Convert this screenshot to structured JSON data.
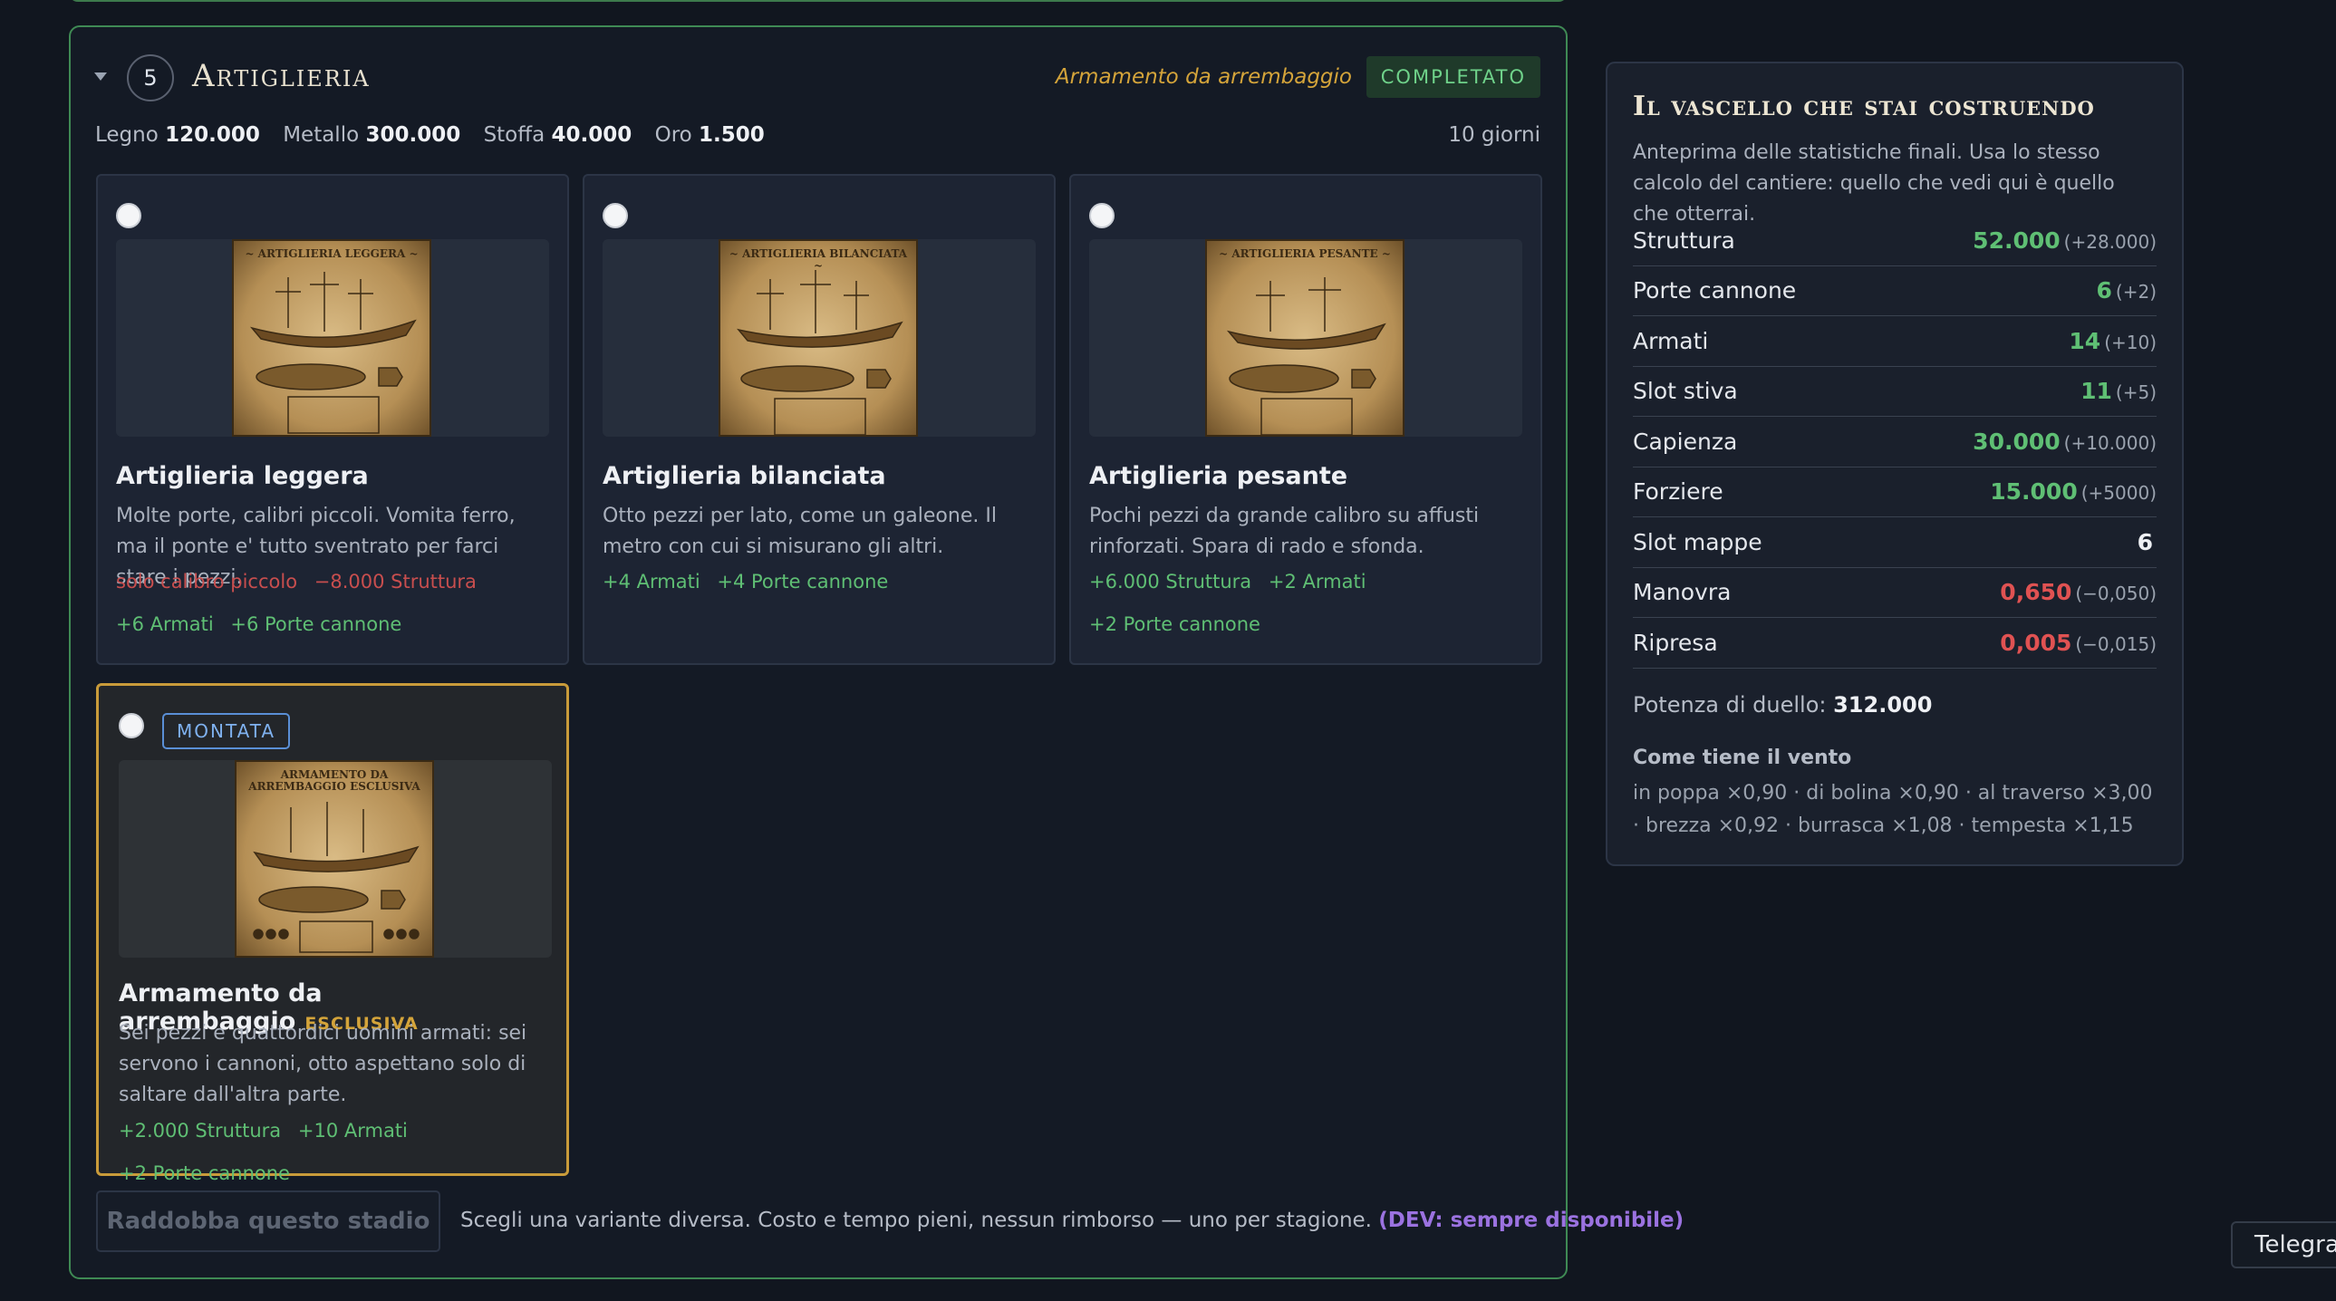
{
  "stage": {
    "number": "5",
    "title": "Artiglieria",
    "selected_label": "Armamento da arrembaggio",
    "status": "COMPLETATO",
    "costs": [
      {
        "name": "Legno",
        "amount": "120.000"
      },
      {
        "name": "Metallo",
        "amount": "300.000"
      },
      {
        "name": "Stoffa",
        "amount": "40.000"
      },
      {
        "name": "Oro",
        "amount": "1.500"
      }
    ],
    "duration": "10 giorni"
  },
  "options": [
    {
      "image_caption": "~ ARTIGLIERIA LEGGERA ~",
      "title": "Artiglieria leggera",
      "description": "Molte porte, calibri piccoli. Vomita ferro, ma il ponte e' tutto sventrato per farci stare i pezzi.",
      "tags": [
        {
          "text": "solo calibro piccolo",
          "kind": "neg"
        },
        {
          "text": "−8.000 Struttura",
          "kind": "neg"
        },
        {
          "text": "+6 Armati",
          "kind": "pos"
        },
        {
          "text": "+6 Porte cannone",
          "kind": "pos"
        }
      ]
    },
    {
      "image_caption": "~ ARTIGLIERIA BILANCIATA ~",
      "title": "Artiglieria bilanciata",
      "description": "Otto pezzi per lato, come un galeone. Il metro con cui si misurano gli altri.",
      "tags": [
        {
          "text": "+4 Armati",
          "kind": "pos"
        },
        {
          "text": "+4 Porte cannone",
          "kind": "pos"
        }
      ]
    },
    {
      "image_caption": "~ ARTIGLIERIA PESANTE ~",
      "title": "Artiglieria pesante",
      "description": "Pochi pezzi da grande calibro su affusti rinforzati. Spara di rado e sfonda.",
      "tags": [
        {
          "text": "+6.000 Struttura",
          "kind": "pos"
        },
        {
          "text": "+2 Armati",
          "kind": "pos"
        },
        {
          "text": "+2 Porte cannone",
          "kind": "pos"
        }
      ]
    },
    {
      "mounted_label": "MONTATA",
      "image_caption": "ARMAMENTO DA ARREMBAGGIO ESCLUSIVA",
      "title": "Armamento da arrembaggio",
      "exclusive_label": "ESCLUSIVA",
      "description": "Sei pezzi e quattordici uomini armati: sei servono i cannoni, otto aspettano solo di saltare dall'altra parte.",
      "tags": [
        {
          "text": "+2.000 Struttura",
          "kind": "pos"
        },
        {
          "text": "+10 Armati",
          "kind": "pos"
        },
        {
          "text": "+2 Porte cannone",
          "kind": "pos"
        }
      ]
    }
  ],
  "footer": {
    "redo_label": "Raddobba questo stadio",
    "text": "Scegli una variante diversa. Costo e tempo pieni, nessun rimborso — uno per stagione.",
    "dev_note": "(DEV: sempre disponibile)"
  },
  "preview": {
    "title": "Il vascello che stai costruendo",
    "description": "Anteprima delle statistiche finali. Usa lo stesso calcolo del cantiere: quello che vedi qui è quello che otterrai.",
    "stats": [
      {
        "name": "Struttura",
        "value": "52.000",
        "delta": "(+28.000)",
        "kind": "pos"
      },
      {
        "name": "Porte cannone",
        "value": "6",
        "delta": "(+2)",
        "kind": "pos"
      },
      {
        "name": "Armati",
        "value": "14",
        "delta": "(+10)",
        "kind": "pos"
      },
      {
        "name": "Slot stiva",
        "value": "11",
        "delta": "(+5)",
        "kind": "pos"
      },
      {
        "name": "Capienza",
        "value": "30.000",
        "delta": "(+10.000)",
        "kind": "pos"
      },
      {
        "name": "Forziere",
        "value": "15.000",
        "delta": "(+5000)",
        "kind": "pos"
      },
      {
        "name": "Slot mappe",
        "value": "6",
        "delta": "",
        "kind": "neu"
      },
      {
        "name": "Manovra",
        "value": "0,650",
        "delta": "(−0,050)",
        "kind": "neg"
      },
      {
        "name": "Ripresa",
        "value": "0,005",
        "delta": "(−0,015)",
        "kind": "neg"
      }
    ],
    "duel_label": "Potenza di duello:",
    "duel_value": "312.000",
    "wind_title": "Come tiene il vento",
    "wind_text": "in poppa ×0,90 · di bolina ×0,90 · al traverso ×3,00 · brezza ×0,92 · burrasca ×1,08 · tempesta ×1,15"
  },
  "telegram_label": "Telegra",
  "colors": {
    "accent_green": "#5fbf74",
    "accent_red": "#e05252",
    "accent_gold": "#d4a43a",
    "accent_blue": "#5a8fd6",
    "accent_purple": "#9b72e0",
    "stage_border": "#3f8a54"
  }
}
